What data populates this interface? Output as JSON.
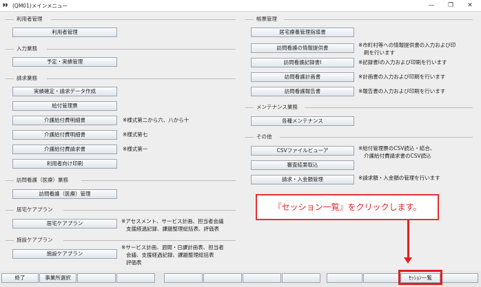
{
  "window": {
    "title": "(QM01)メインメニュー",
    "app_icon": "app-icon",
    "controls": [
      "minimize-icon",
      "restore-icon",
      "close-icon"
    ]
  },
  "left": {
    "riyousha": {
      "label": "利用者管理",
      "buttons": [
        "利用者管理"
      ]
    },
    "nyusho": {
      "label": "入力業務",
      "buttons": [
        "予定・実績管理"
      ]
    },
    "seikyu": {
      "label": "請求業務",
      "buttons": [
        "実績確定・請求データ作成",
        "給付管理票",
        "介護給付費明細書",
        "介護給付費明細書",
        "介護給付費請求書",
        "利用者向け印刷"
      ],
      "notes": [
        "※様式第二から六、八から十",
        "※様式第七",
        "※様式第一"
      ]
    },
    "houmon": {
      "label": "訪問看護（医療）業務",
      "buttons": [
        "訪問看護（医療）管理"
      ]
    },
    "kyotaku": {
      "label": "居宅ケアプラン",
      "buttons": [
        "居宅ケアプラン"
      ],
      "note_lines": [
        "※アセスメント、サービス計画、担当者会議",
        "支援経過記録、課題整理総括表、評価表"
      ]
    },
    "shisetsu": {
      "label": "施設ケアプラン",
      "buttons": [
        "施設ケアプラン"
      ],
      "note_lines": [
        "※サービス計画、週間・日課計画表、担当者",
        "会議、支援経過記録、課題整理総括表",
        "評価表"
      ]
    }
  },
  "right": {
    "chohyo": {
      "label": "帳票管理",
      "buttons": [
        "居宅療養管理指導書",
        "訪問看護の情報提供書",
        "訪問看護記録書Ⅰ",
        "訪問看護計画書",
        "訪問看護報告書"
      ],
      "note1_lines": [
        "※市町村等への情報提供書の入力および印",
        "刷を行います"
      ],
      "notes": [
        "※記録書Ⅰの入力および印刷を行います",
        "※計画書の入力および印刷を行います",
        "※報告書の入力および印刷を行います"
      ]
    },
    "maintenance": {
      "label": "メンテナンス業務",
      "buttons": [
        "各種メンテナンス"
      ]
    },
    "other": {
      "label": "その他",
      "buttons": [
        "CSVファイルビューア",
        "審査結果取込",
        "請求・入金額管理"
      ],
      "csv_note_lines": [
        "※給付管理票のCSV読込・結合、",
        "介護給付費請求書のCSV読込"
      ],
      "billing_note": "※請求額・入金額の管理を行います"
    }
  },
  "callout": {
    "text": "『セッション一覧』をクリックします。"
  },
  "footer": {
    "exit": "終了",
    "office_select": "事業所選択",
    "session_list": "ｾｯｼｮﾝ一覧"
  },
  "colors": {
    "accent_red": "#e02020",
    "button_border": "#9aa4b0",
    "background": "#eeeeee"
  }
}
